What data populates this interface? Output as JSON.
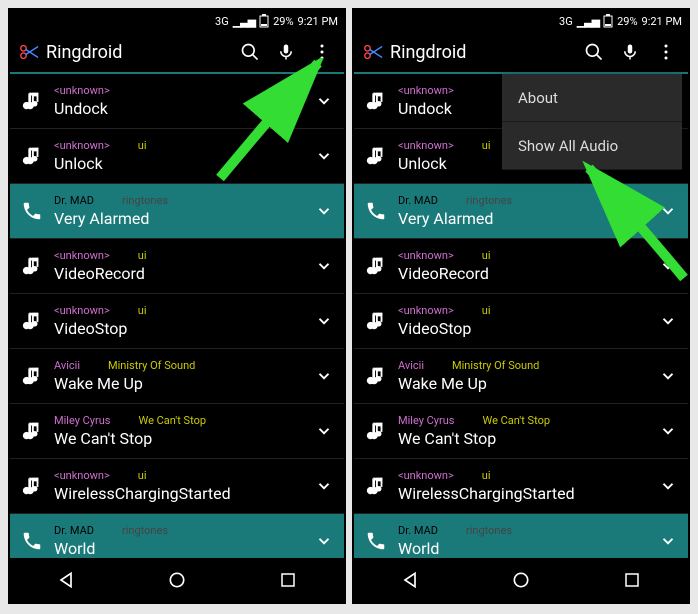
{
  "status": {
    "network": "3G",
    "battery": "29%",
    "time": "9:21 PM"
  },
  "app": {
    "title": "Ringdroid"
  },
  "menu": {
    "item1": "About",
    "item2": "Show All Audio"
  },
  "tracks": [
    {
      "artist": "<unknown>",
      "album": "",
      "name": "Undock",
      "type": "music"
    },
    {
      "artist": "<unknown>",
      "album": "ui",
      "name": "Unlock",
      "type": "music"
    },
    {
      "artist": "Dr. MAD",
      "album": "ringtones",
      "name": "Very Alarmed",
      "type": "ringtone"
    },
    {
      "artist": "<unknown>",
      "album": "ui",
      "name": "VideoRecord",
      "type": "music"
    },
    {
      "artist": "<unknown>",
      "album": "ui",
      "name": "VideoStop",
      "type": "music"
    },
    {
      "artist": "Avicii",
      "album": "Ministry Of Sound",
      "name": "Wake Me Up",
      "type": "music"
    },
    {
      "artist": "Miley Cyrus",
      "album": "We Can't Stop",
      "name": "We Can't Stop",
      "type": "music"
    },
    {
      "artist": "<unknown>",
      "album": "ui",
      "name": "WirelessChargingStarted",
      "type": "music"
    },
    {
      "artist": "Dr. MAD",
      "album": "ringtones",
      "name": "World",
      "type": "ringtone"
    }
  ]
}
